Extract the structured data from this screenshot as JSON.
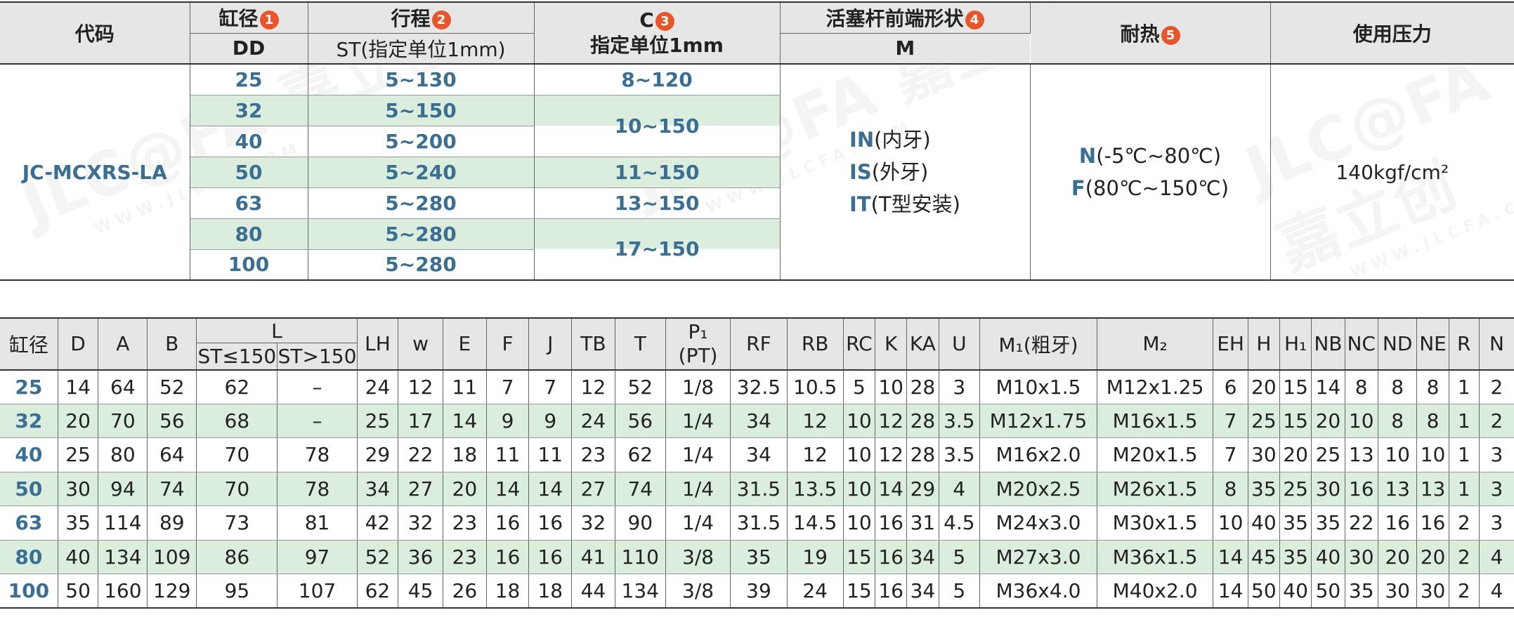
{
  "top_table": {
    "headers": {
      "code": "代码",
      "bore": "缸径",
      "bore_num": "1",
      "bore_sub": "DD",
      "stroke": "行程",
      "stroke_num": "2",
      "stroke_sub": "ST(指定单位1mm)",
      "c": "C",
      "c_num": "3",
      "c_sub": "指定单位1mm",
      "rod": "活塞杆前端形状",
      "rod_num": "4",
      "rod_sub": "M",
      "heat": "耐热",
      "heat_num": "5",
      "pressure": "使用压力"
    },
    "code_value": "JC-MCXRS-LA",
    "rows": [
      {
        "dd": "25",
        "st": "5~130"
      },
      {
        "dd": "32",
        "st": "5~150"
      },
      {
        "dd": "40",
        "st": "5~200"
      },
      {
        "dd": "50",
        "st": "5~240"
      },
      {
        "dd": "63",
        "st": "5~280"
      },
      {
        "dd": "80",
        "st": "5~280"
      },
      {
        "dd": "100",
        "st": "5~280"
      }
    ],
    "c_values": [
      "8~120",
      "10~150",
      "11~150",
      "13~150",
      "17~150"
    ],
    "rod_options": [
      {
        "code": "IN",
        "desc": "(内牙)"
      },
      {
        "code": "IS",
        "desc": "(外牙)"
      },
      {
        "code": "IT",
        "desc": "(T型安装)"
      }
    ],
    "heat_options": [
      {
        "code": "N",
        "desc": "(-5℃~80℃)"
      },
      {
        "code": "F",
        "desc": "(80℃~150℃)"
      }
    ],
    "pressure_value": "140kgf/cm²"
  },
  "dim_table": {
    "headers": [
      "缸径",
      "D",
      "A",
      "B",
      "L",
      "LH",
      "w",
      "E",
      "F",
      "J",
      "TB",
      "T",
      "P₁ (PT)",
      "RF",
      "RB",
      "RC",
      "K",
      "KA",
      "U",
      "M₁(粗牙)",
      "M₂",
      "EH",
      "H",
      "H₁",
      "NB",
      "NC",
      "ND",
      "NE",
      "R",
      "N"
    ],
    "l_subheaders": [
      "ST≤150",
      "ST>150"
    ],
    "rows": [
      [
        "25",
        "14",
        "64",
        "52",
        "62",
        "–",
        "24",
        "12",
        "11",
        "7",
        "7",
        "12",
        "52",
        "1/8",
        "32.5",
        "10.5",
        "5",
        "10",
        "28",
        "3",
        "M10x1.5",
        "M12x1.25",
        "6",
        "20",
        "15",
        "14",
        "8",
        "8",
        "8",
        "1",
        "2"
      ],
      [
        "32",
        "20",
        "70",
        "56",
        "68",
        "–",
        "25",
        "17",
        "14",
        "9",
        "9",
        "24",
        "56",
        "1/4",
        "34",
        "12",
        "10",
        "12",
        "28",
        "3.5",
        "M12x1.75",
        "M16x1.5",
        "7",
        "25",
        "15",
        "20",
        "10",
        "8",
        "8",
        "1",
        "2"
      ],
      [
        "40",
        "25",
        "80",
        "64",
        "70",
        "78",
        "29",
        "22",
        "18",
        "11",
        "11",
        "23",
        "62",
        "1/4",
        "34",
        "12",
        "10",
        "12",
        "28",
        "3.5",
        "M16x2.0",
        "M20x1.5",
        "7",
        "30",
        "20",
        "25",
        "13",
        "10",
        "10",
        "1",
        "3"
      ],
      [
        "50",
        "30",
        "94",
        "74",
        "70",
        "78",
        "34",
        "27",
        "20",
        "14",
        "14",
        "27",
        "74",
        "1/4",
        "31.5",
        "13.5",
        "10",
        "14",
        "29",
        "4",
        "M20x2.5",
        "M26x1.5",
        "8",
        "35",
        "25",
        "30",
        "16",
        "13",
        "13",
        "1",
        "3"
      ],
      [
        "63",
        "35",
        "114",
        "89",
        "73",
        "81",
        "42",
        "32",
        "23",
        "16",
        "16",
        "32",
        "90",
        "1/4",
        "31.5",
        "14.5",
        "10",
        "16",
        "31",
        "4.5",
        "M24x3.0",
        "M30x1.5",
        "10",
        "40",
        "35",
        "35",
        "22",
        "16",
        "16",
        "2",
        "3"
      ],
      [
        "80",
        "40",
        "134",
        "109",
        "86",
        "97",
        "52",
        "36",
        "23",
        "16",
        "16",
        "41",
        "110",
        "3/8",
        "35",
        "19",
        "15",
        "16",
        "34",
        "5",
        "M27x3.0",
        "M36x1.5",
        "14",
        "45",
        "35",
        "40",
        "30",
        "20",
        "20",
        "2",
        "4"
      ],
      [
        "100",
        "50",
        "160",
        "129",
        "95",
        "107",
        "62",
        "45",
        "26",
        "18",
        "18",
        "44",
        "134",
        "3/8",
        "39",
        "24",
        "15",
        "16",
        "34",
        "5",
        "M36x4.0",
        "M40x2.0",
        "14",
        "50",
        "40",
        "50",
        "35",
        "30",
        "30",
        "2",
        "4"
      ]
    ]
  }
}
